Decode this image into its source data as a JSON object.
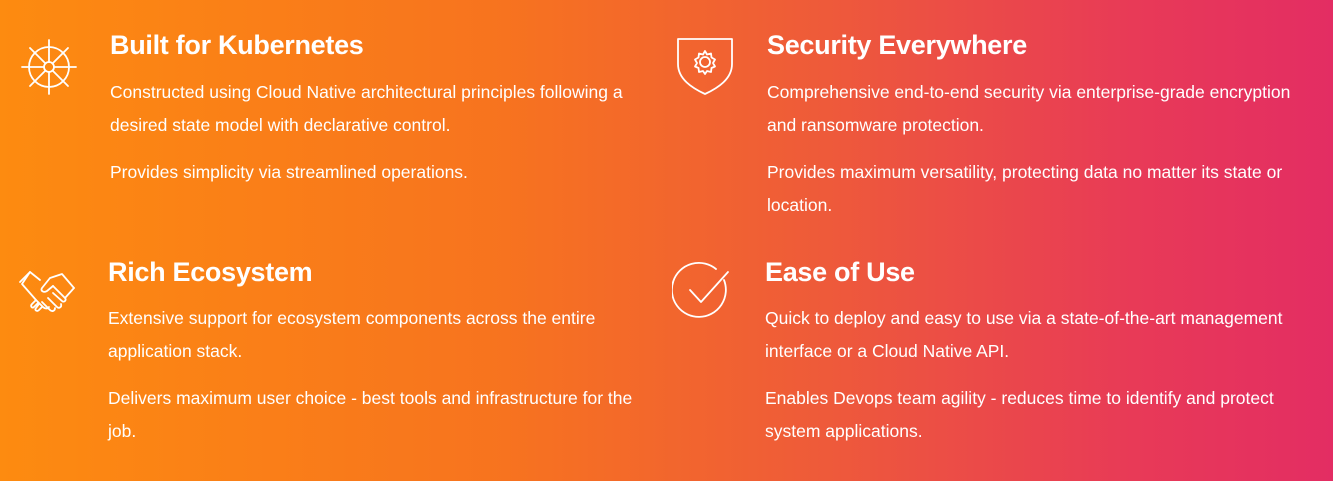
{
  "colors": {
    "gradient_start": "#fd8b10",
    "gradient_end": "#e32d63",
    "text": "#ffffff"
  },
  "features": [
    {
      "icon": "helm-wheel-icon",
      "title": "Built for Kubernetes",
      "paragraphs": [
        "Constructed using Cloud Native architectural principles following a desired state model with declarative control.",
        "Provides simplicity via streamlined operations."
      ]
    },
    {
      "icon": "shield-gear-icon",
      "title": "Security Everywhere",
      "paragraphs": [
        "Comprehensive end-to-end security via enterprise-grade encryption and ransomware protection.",
        "Provides maximum versatility, protecting data no matter its state or location."
      ]
    },
    {
      "icon": "handshake-icon",
      "title": "Rich Ecosystem",
      "paragraphs": [
        "Extensive support for ecosystem components across the entire application stack.",
        "Delivers maximum user choice - best tools and infrastructure for the job."
      ]
    },
    {
      "icon": "check-circle-icon",
      "title": "Ease of Use",
      "paragraphs": [
        "Quick to deploy and easy to use via a state-of-the-art management interface or a Cloud Native API.",
        "Enables Devops team agility - reduces time to identify and protect system applications."
      ]
    }
  ]
}
